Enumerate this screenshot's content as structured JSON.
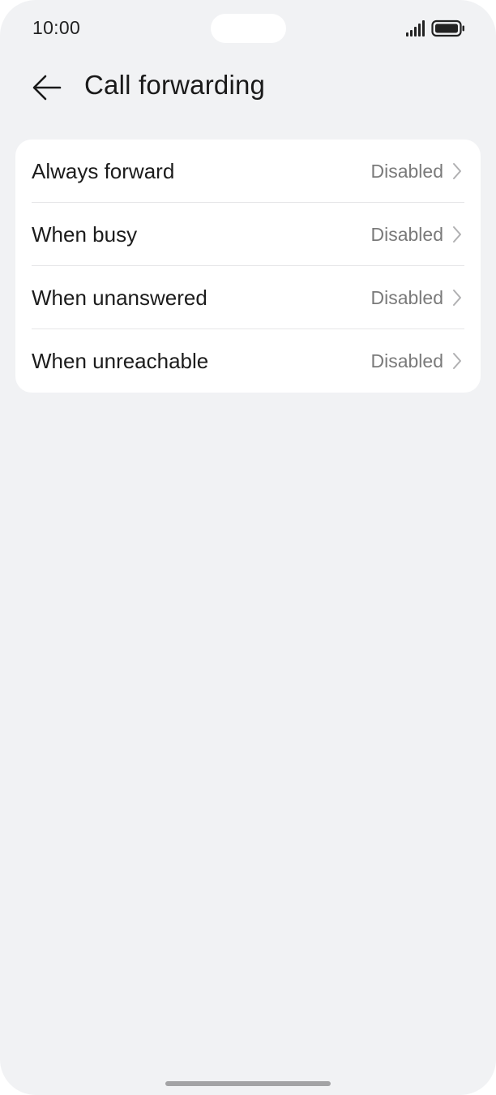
{
  "status_bar": {
    "time": "10:00",
    "signal_icon": "signal-bars-icon",
    "battery_icon": "battery-full-icon"
  },
  "header": {
    "back_icon": "arrow-left-icon",
    "title": "Call forwarding"
  },
  "settings": {
    "items": [
      {
        "label": "Always forward",
        "value": "Disabled",
        "icon": "chevron-right-icon"
      },
      {
        "label": "When busy",
        "value": "Disabled",
        "icon": "chevron-right-icon"
      },
      {
        "label": "When unanswered",
        "value": "Disabled",
        "icon": "chevron-right-icon"
      },
      {
        "label": "When unreachable",
        "value": "Disabled",
        "icon": "chevron-right-icon"
      }
    ]
  },
  "colors": {
    "background": "#f1f2f4",
    "card": "#ffffff",
    "primary_text": "#1c1c1c",
    "secondary_text": "#7a7a7a",
    "divider": "#e6e6e8"
  }
}
